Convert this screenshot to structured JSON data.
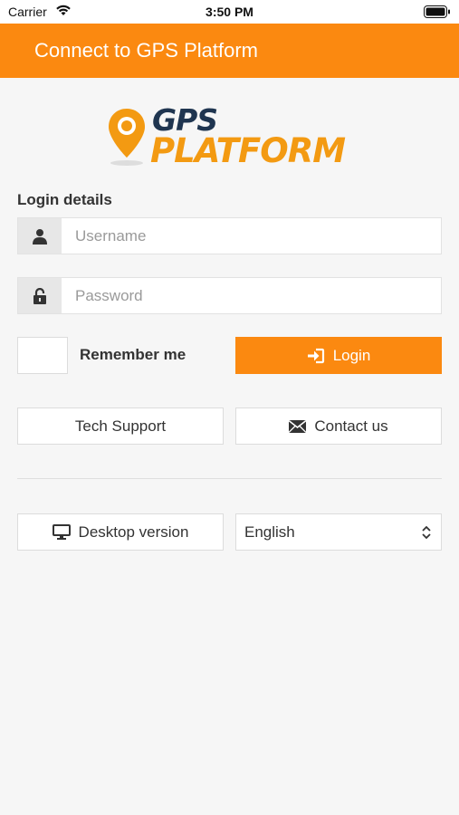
{
  "status_bar": {
    "carrier": "Carrier",
    "time": "3:50 PM"
  },
  "header": {
    "title": "Connect to GPS Platform"
  },
  "logo": {
    "line1": "GPS",
    "line2": "PLATFORM",
    "colors": {
      "dark": "#1f3550",
      "orange": "#f39a12"
    }
  },
  "form": {
    "section_label": "Login details",
    "username": {
      "placeholder": "Username",
      "value": "",
      "icon": "user-icon"
    },
    "password": {
      "placeholder": "Password",
      "value": "",
      "icon": "lock-icon"
    },
    "remember_label": "Remember me",
    "remember_checked": false,
    "login_label": "Login",
    "login_icon": "sign-in-icon"
  },
  "links": {
    "tech_support": "Tech Support",
    "contact_us": "Contact us",
    "contact_icon": "envelope-icon"
  },
  "footer": {
    "desktop_version": "Desktop version",
    "desktop_icon": "monitor-icon",
    "language_selected": "English"
  },
  "colors": {
    "accent": "#fb8910",
    "background": "#f6f6f6"
  }
}
